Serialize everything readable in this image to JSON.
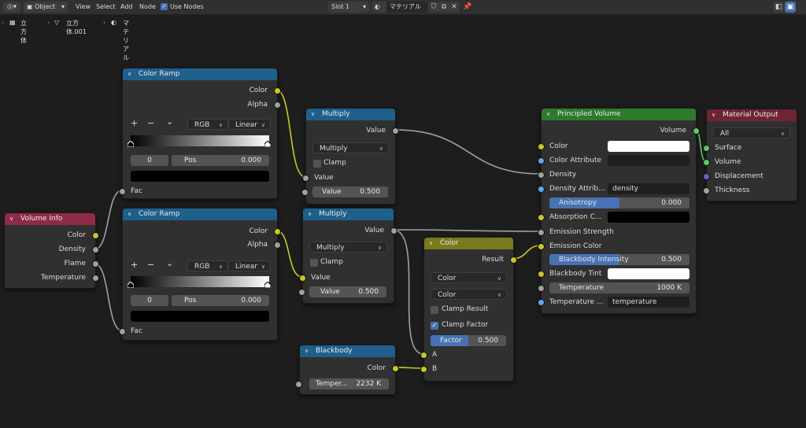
{
  "topbar": {
    "mode": "Object",
    "menu": [
      "View",
      "Select",
      "Add",
      "Node"
    ],
    "use_nodes": "Use Nodes",
    "slot": "Slot 1",
    "material": "マテリアル"
  },
  "breadcrumb": {
    "object": "立方体",
    "mesh": "立方体.001",
    "material": "マテリアル"
  },
  "colors": {
    "vector_header": "#1f5f8c",
    "input_header": "#8e2b48",
    "converter_header": "#7a7a1e",
    "shader_header": "#2d7a2d",
    "output_header": "#6e2432",
    "socket_color": "#c7c729",
    "socket_float": "#a1a1a1",
    "socket_shader": "#63c763",
    "socket_vector": "#6363c7",
    "accent": "#4772b3"
  },
  "volume_info": {
    "title": "Volume Info",
    "outputs": [
      "Color",
      "Density",
      "Flame",
      "Temperature"
    ]
  },
  "color_ramp_1": {
    "title": "Color Ramp",
    "outputs": [
      "Color",
      "Alpha"
    ],
    "plus": "+",
    "minus": "−",
    "menu": "⌄",
    "mode": "RGB",
    "interp": "Linear",
    "index": "0",
    "pos_label": "Pos",
    "pos_value": "0.000",
    "input": "Fac"
  },
  "color_ramp_2": {
    "title": "Color Ramp",
    "outputs": [
      "Color",
      "Alpha"
    ],
    "plus": "+",
    "minus": "−",
    "menu": "⌄",
    "mode": "RGB",
    "interp": "Linear",
    "index": "0",
    "pos_label": "Pos",
    "pos_value": "0.000",
    "input": "Fac"
  },
  "multiply_1": {
    "title": "Multiply",
    "output": "Value",
    "operation": "Multiply",
    "clamp": "Clamp",
    "input": "Value",
    "field_label": "Value",
    "field_value": "0.500"
  },
  "multiply_2": {
    "title": "Multiply",
    "output": "Value",
    "operation": "Multiply",
    "clamp": "Clamp",
    "input": "Value",
    "field_label": "Value",
    "field_value": "0.500"
  },
  "blackbody": {
    "title": "Blackbody",
    "output": "Color",
    "field_label": "Temper...",
    "field_value": "2232 K"
  },
  "mix_color": {
    "title": "Color",
    "output": "Result",
    "data_type": "Color",
    "blend": "Color",
    "clamp_result": "Clamp Result",
    "clamp_factor": "Clamp Factor",
    "factor_label": "Factor",
    "factor_value": "0.500",
    "factor": 0.5,
    "input_a": "A",
    "input_b": "B"
  },
  "principled_volume": {
    "title": "Principled Volume",
    "output": "Volume",
    "color": "Color",
    "color_attribute": "Color Attribute",
    "density": "Density",
    "density_attribute": "Density Attrib...",
    "density_attribute_value": "density",
    "anisotropy_label": "Anisotropy",
    "anisotropy_value": "0.000",
    "absorption": "Absorption C...",
    "emission_strength": "Emission Strength",
    "emission_color": "Emission Color",
    "bb_intensity_label": "Blackbody Intensity",
    "bb_intensity_value": "0.500",
    "bb_intensity": 0.5,
    "bb_tint": "Blackbody Tint",
    "temp_label": "Temperature",
    "temp_value": "1000 K",
    "temp_attribute": "Temperature ...",
    "temp_attribute_value": "temperature"
  },
  "material_output": {
    "title": "Material Output",
    "target": "All",
    "inputs": [
      "Surface",
      "Volume",
      "Displacement",
      "Thickness"
    ]
  }
}
